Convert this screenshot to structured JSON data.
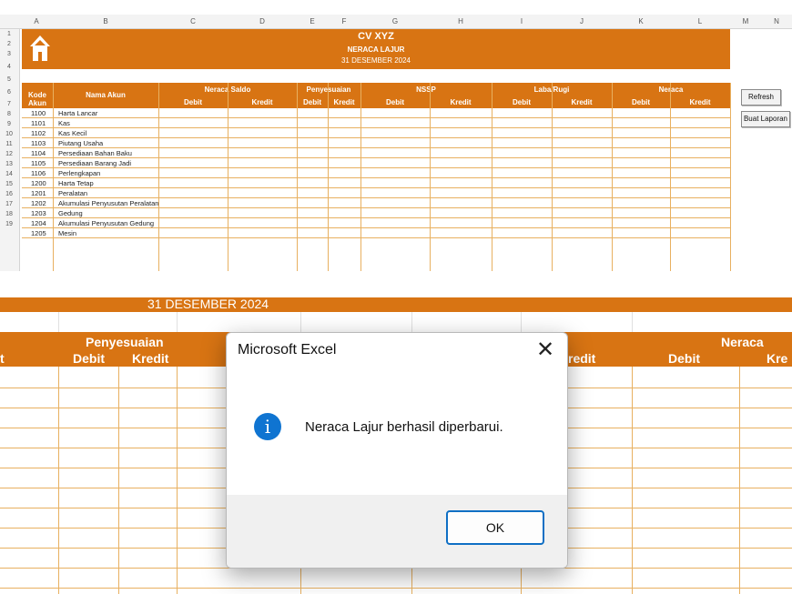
{
  "columns": [
    "A",
    "B",
    "C",
    "D",
    "E",
    "F",
    "G",
    "H",
    "I",
    "J",
    "K",
    "L",
    "M",
    "N"
  ],
  "rows": [
    "1",
    "2",
    "3",
    "4",
    "5",
    "6",
    "7",
    "8",
    "9",
    "10",
    "11",
    "12",
    "13",
    "14",
    "15",
    "16",
    "17",
    "18",
    "19"
  ],
  "banner": {
    "title": "CV XYZ",
    "subtitle": "NERACA LAJUR",
    "date": "31 DESEMBER 2024"
  },
  "table_header": {
    "kode_akun": "Kode Akun",
    "nama_akun": "Nama Akun",
    "groups": [
      "Neraca Saldo",
      "Penyesuaian",
      "NSSP",
      "Laba/Rugi",
      "Neraca"
    ],
    "debit": "Debit",
    "kredit": "Kredit"
  },
  "accounts": [
    {
      "code": "1100",
      "name": "Harta Lancar"
    },
    {
      "code": "1101",
      "name": "Kas"
    },
    {
      "code": "1102",
      "name": "Kas Kecil"
    },
    {
      "code": "1103",
      "name": "Piutang Usaha"
    },
    {
      "code": "1104",
      "name": "Persediaan Bahan Baku"
    },
    {
      "code": "1105",
      "name": "Persediaan Barang Jadi"
    },
    {
      "code": "1106",
      "name": "Perlengkapan"
    },
    {
      "code": "1200",
      "name": "Harta Tetap"
    },
    {
      "code": "1201",
      "name": "Peralatan"
    },
    {
      "code": "1202",
      "name": "Akumulasi Penyusutan Peralatan"
    },
    {
      "code": "1203",
      "name": "Gedung"
    },
    {
      "code": "1204",
      "name": "Akumulasi Penyusutan Gedung"
    },
    {
      "code": "1205",
      "name": "Mesin"
    }
  ],
  "sheet_buttons": {
    "refresh": "Refresh",
    "buat_laporan": "Buat Laporan"
  },
  "zoomed": {
    "band_date": "31 DESEMBER 2024",
    "penyesuaian": "Penyesuaian",
    "neraca": "Neraca",
    "debit": "Debit",
    "kredit": "Kredit",
    "partial_kredit_left": "t",
    "partial_kredit_mid": "redit",
    "partial_kredit_right": "Kre"
  },
  "dialog": {
    "title": "Microsoft Excel",
    "message": "Neraca Lajur berhasil diperbarui.",
    "ok_label": "OK",
    "close_glyph": "✕",
    "info_glyph": "i"
  },
  "colors": {
    "accent": "#d87413",
    "grid": "#e8b060",
    "dialog_info": "#0f74d1"
  }
}
